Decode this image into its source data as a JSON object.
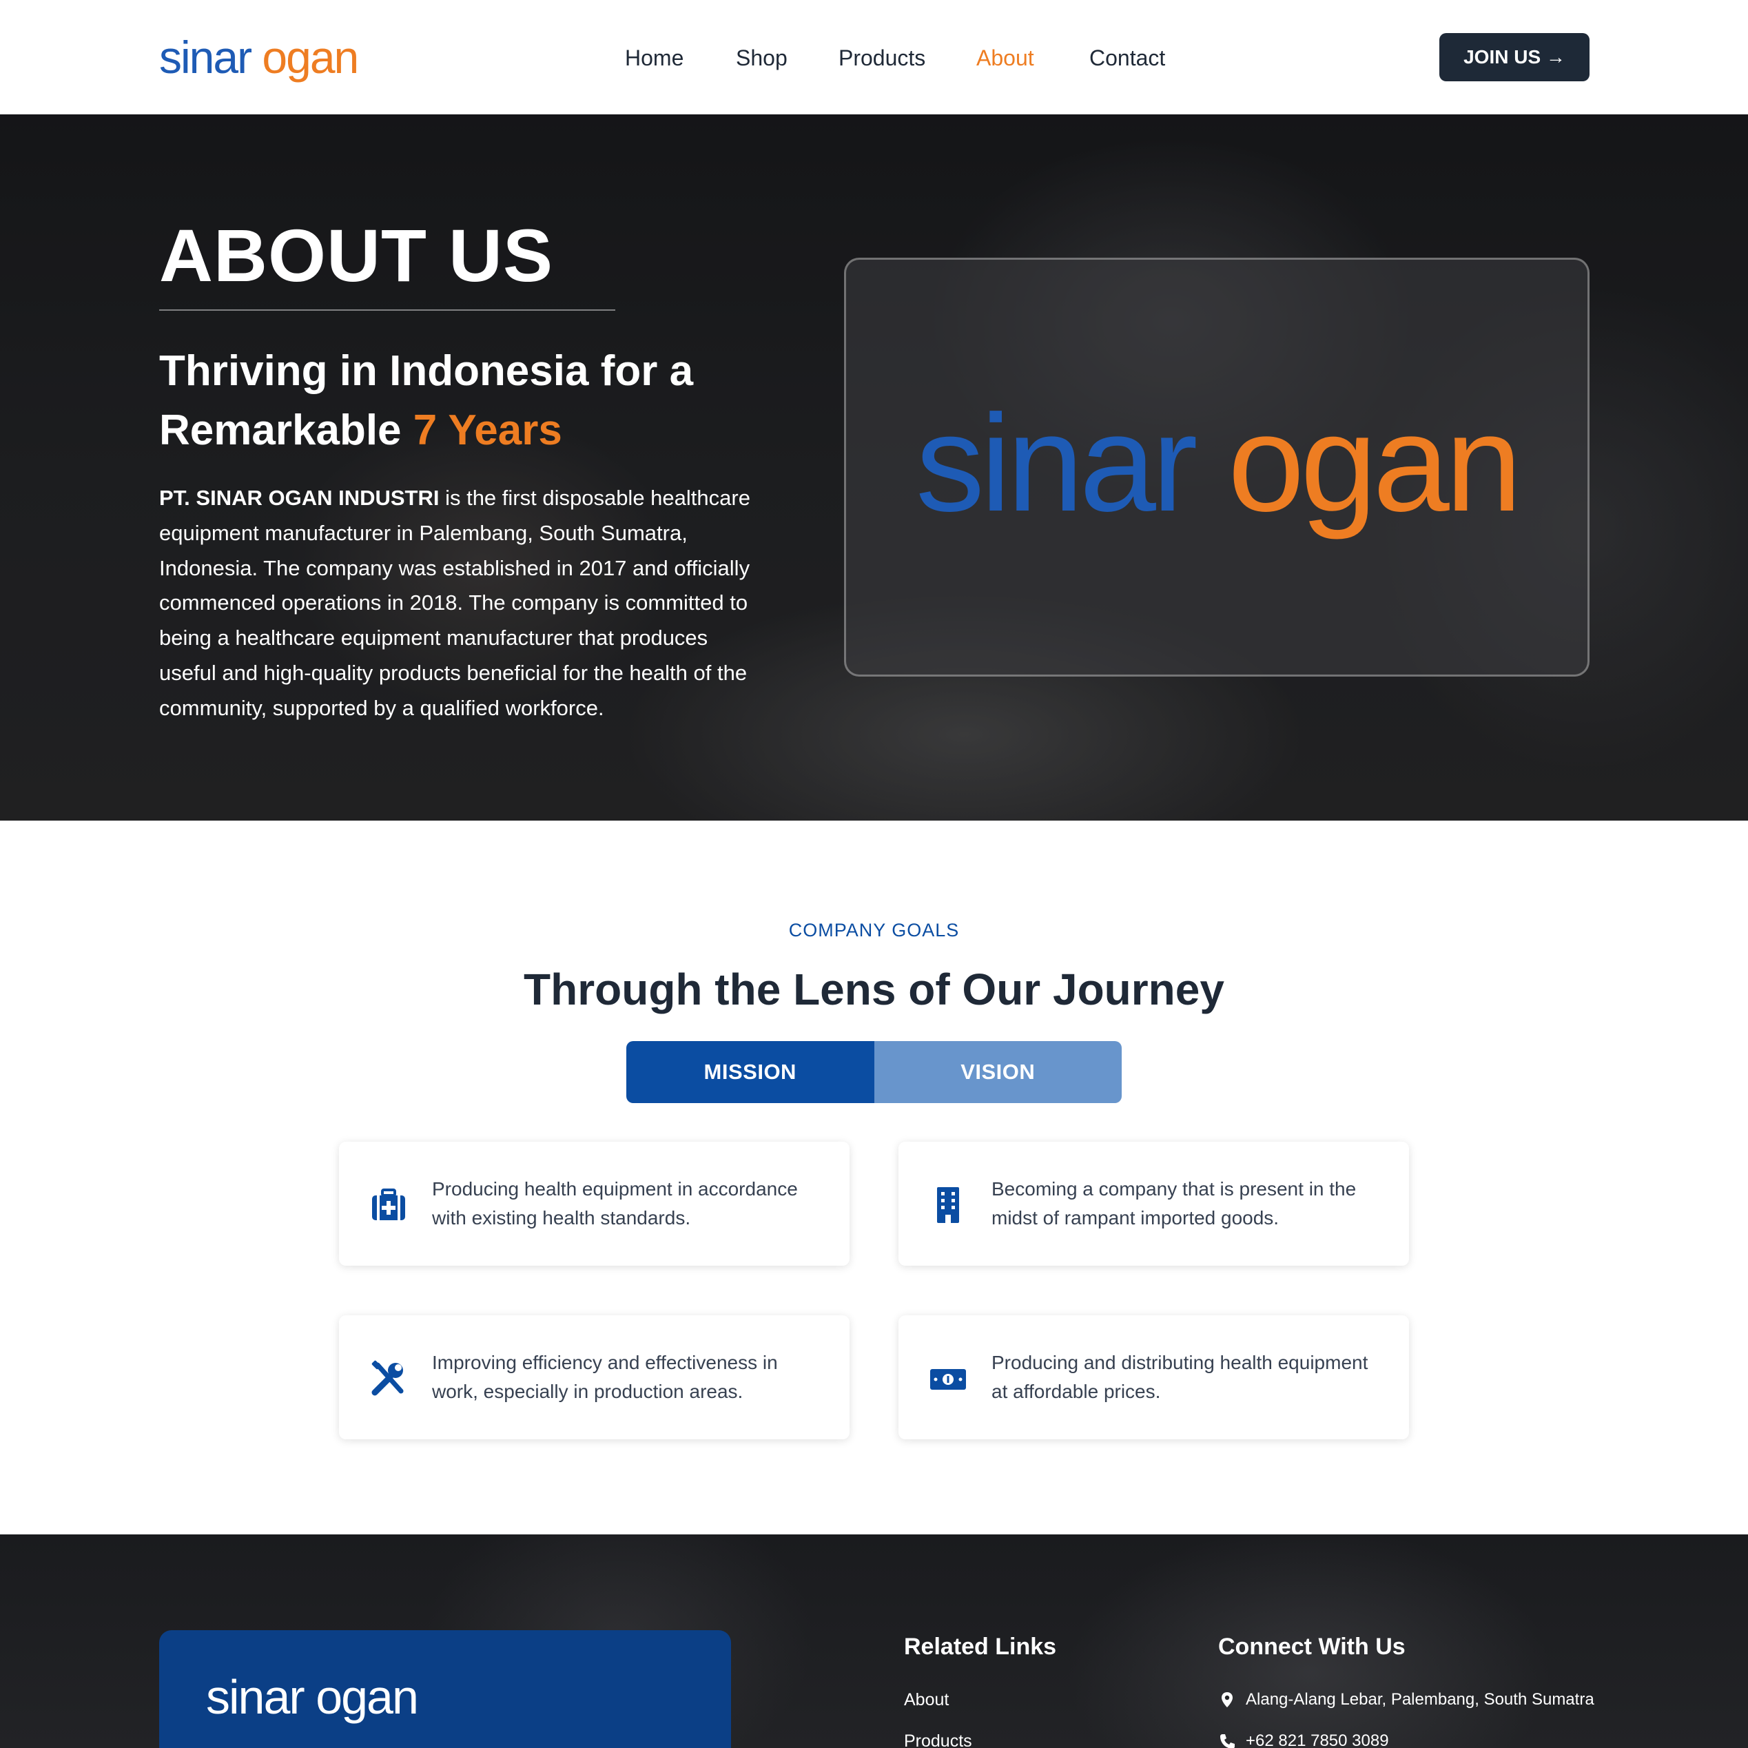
{
  "brand": {
    "word1": "sinar",
    "word2": "ogan",
    "blue": "#1e5bb5",
    "orange": "#ee7d22"
  },
  "nav": {
    "links": [
      "Home",
      "Shop",
      "Products",
      "About",
      "Contact"
    ],
    "active": "About",
    "cta": "JOIN US →"
  },
  "hero": {
    "title": "ABOUT US",
    "subtitle_pre": "Thriving in Indonesia for a Remarkable ",
    "subtitle_highlight": "7 Years",
    "company_name": "PT. SINAR OGAN INDUSTRI",
    "description": " is the first disposable healthcare equipment manufacturer in Palembang, South Sumatra, Indonesia. The company was established in 2017 and officially commenced operations in 2018. The company is committed to being a healthcare equipment manufacturer that produces useful and high-quality products beneficial for the health of the community, supported by a qualified workforce."
  },
  "goals": {
    "eyebrow": "COMPANY GOALS",
    "title": "Through the Lens of Our Journey",
    "tabs": [
      {
        "label": "MISSION",
        "active": true
      },
      {
        "label": "VISION",
        "active": false
      }
    ],
    "cards": [
      {
        "icon": "medical-kit-icon",
        "text": "Producing health equipment in accordance with existing health standards."
      },
      {
        "icon": "building-icon",
        "text": "Becoming a company that is present in the midst of rampant imported goods."
      },
      {
        "icon": "tools-icon",
        "text": "Improving efficiency and effectiveness in work, especially in production areas."
      },
      {
        "icon": "money-bill-icon",
        "text": "Producing and distributing health equipment at affordable prices."
      }
    ]
  },
  "footer": {
    "related_heading": "Related Links",
    "related_links": [
      "About",
      "Products"
    ],
    "connect_heading": "Connect With Us",
    "address": "Alang-Alang Lebar, Palembang, South Sumatra",
    "phone": "+62 821 7850 3089"
  },
  "colors": {
    "primary": "#0b4da2",
    "accent": "#ee7d22",
    "dark": "#1e2937",
    "tab_inactive": "#6895cc"
  }
}
